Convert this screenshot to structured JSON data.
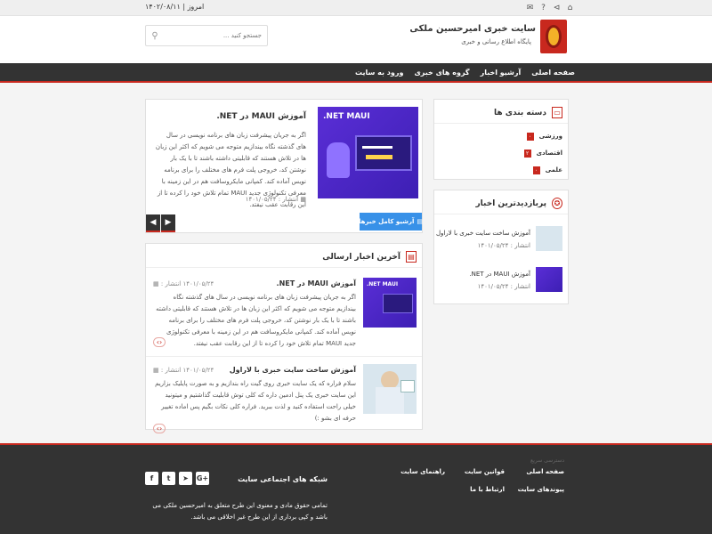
{
  "topbar": {
    "date_label": "امروز",
    "date_value": "۱۴۰۲/۰۸/۱۱",
    "icons": [
      "home-icon",
      "help-icon",
      "share-icon",
      "mail-icon"
    ]
  },
  "header": {
    "title": "سایت خبری امیرحسین ملکی",
    "subtitle": "پایگاه اطلاع رسانی و خبری",
    "search_placeholder": "جستجو کنید ..."
  },
  "nav": {
    "items": [
      "صفحه اصلی",
      "آرشیو اخبار",
      "گروه های خبری",
      "ورود به سایت"
    ]
  },
  "featured": {
    "image_text": ".NET MAUI",
    "title": "آموزش MAUI در NET.",
    "text": "اگر به جریان پیشرفت زبان های برنامه نویسی در سال های گذشته نگاه بیندازیم متوجه می شویم که اکثر این زبان ها در تلاش هستند که قابلیتی داشته باشند تا با یک بار نوشتن کد، خروجی پلت فرم های مختلف را برای برنامه نویس آماده کند. کمپانی مایکروسافت هم در این زمینه با معرفی تکنولوژی جدید MAUI تمام تلاش خود را کرده تا از این رقابت عقب نیفتد.",
    "date_label": "انتشار :",
    "date": "۱۴۰۱/۰۵/۲۴",
    "archive_label": "آرشیو کامل خبرها"
  },
  "latest": {
    "title": "آخرین اخبار ارسالی",
    "items": [
      {
        "thumb_text": ".NET MAUI",
        "title": "آموزش MAUI در NET.",
        "date_label": "انتشار :",
        "date": "۱۴۰۱/۰۵/۲۴",
        "text": "اگر به جریان پیشرفت زبان های برنامه نویسی در سال های گذشته نگاه بیندازیم متوجه می شویم که اکثر این زبان ها در تلاش هستند که قابلیتی داشته باشند تا با یک بار نوشتن کد، خروجی پلت فرم های مختلف را برای برنامه نویس آماده کند. کمپانی مایکروسافت هم در این زمینه با معرفی تکنولوژی جدید MAUI تمام تلاش خود را کرده تا از این رقابت عقب نیفتد."
      },
      {
        "title": "آموزش ساخت سایت خبری با لاراول",
        "date_label": "انتشار :",
        "date": "۱۴۰۱/۰۵/۲۴",
        "text": "سلام فراره که یک سایت خبری روی گیت راه بندازیم و به صورت پایلیک بزاریم این سایت خبری یک پنل ادمین داره که کلی توش قابلیت گذاشتیم و میتونید خیلی راحت استفاده کنید و لذت ببرید. فراره کلی نکات بگیم پس اماده تغییر حرفه ای بشو :)"
      }
    ]
  },
  "categories": {
    "title": "دسته بندی ها",
    "items": [
      {
        "label": "ورزشی",
        "count": "۰"
      },
      {
        "label": "اقتصادی",
        "count": "۲"
      },
      {
        "label": "علمی",
        "count": "۰"
      }
    ]
  },
  "popular": {
    "title": "پربازدیدترین اخبار",
    "items": [
      {
        "title": "آموزش ساخت سایت خبری با لاراول",
        "date_label": "انتشار :",
        "date": "۱۴۰۱/۰۵/۲۴"
      },
      {
        "title": "آموزش MAUI در NET.",
        "date_label": "انتشار :",
        "date": "۱۴۰۱/۰۵/۲۴"
      }
    ]
  },
  "footer": {
    "small_text": "دسترسی سریع",
    "links": [
      "صفحه اصلی",
      "قوانین سایت",
      "راهنمای سایت",
      "پیوندهای سایت",
      "ارتباط با ما"
    ],
    "social_title": "شبکه های اجتماعی سایت",
    "social": [
      "G+",
      "➤",
      "t",
      "f"
    ],
    "copyright": "تمامی حقوق مادی و معنوی این طرح متعلق به امیرحسین ملکی می باشد و کپی برداری از این طرح غیر اخلاقی می باشد."
  },
  "colors": {
    "accent": "#c8281e",
    "dark": "#333333",
    "button_blue": "#3891e8"
  }
}
